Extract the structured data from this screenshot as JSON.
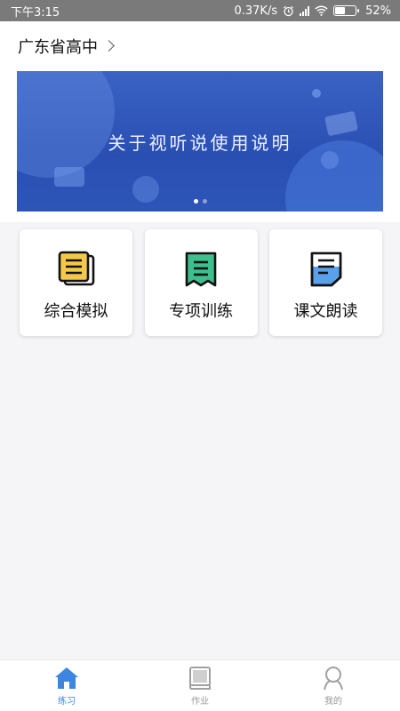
{
  "status_bar": {
    "time": "下午3:15",
    "network_speed": "0.37K/s",
    "battery_percent": "52%",
    "battery_level": 0.52
  },
  "header": {
    "region": "广东省高中"
  },
  "banner": {
    "title": "关于视听说使用说明",
    "slide_count": 2,
    "active_slide": 1
  },
  "cards": [
    {
      "label": "综合模拟",
      "icon": "document-list-icon",
      "color": "#f4c84a"
    },
    {
      "label": "专项训练",
      "icon": "bookmark-list-icon",
      "color": "#3ec08e"
    },
    {
      "label": "课文朗读",
      "icon": "text-page-icon",
      "color": "#5aa0ea"
    }
  ],
  "bottom_nav": {
    "items": [
      {
        "label": "练习",
        "icon": "home-icon",
        "active": true
      },
      {
        "label": "作业",
        "icon": "book-icon",
        "active": false
      },
      {
        "label": "我的",
        "icon": "user-icon",
        "active": false
      }
    ]
  },
  "colors": {
    "accent": "#3c86e0",
    "banner": "#2d55b8"
  }
}
